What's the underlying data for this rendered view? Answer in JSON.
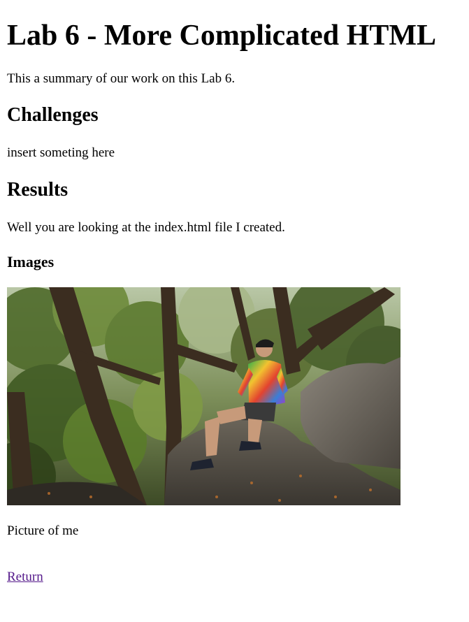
{
  "page": {
    "title": "Lab 6 - More Complicated HTML",
    "summary": "This a summary of our work on this Lab 6.",
    "sections": {
      "challenges": {
        "heading": "Challenges",
        "text": "insert someting here"
      },
      "results": {
        "heading": "Results",
        "text": "Well you are looking at the index.html file I created."
      },
      "images": {
        "heading": "Images",
        "caption": "Picture of me"
      }
    },
    "return_link": "Return",
    "colors": {
      "visited_link": "#551a8b",
      "text": "#000000",
      "background": "#ffffff"
    }
  }
}
